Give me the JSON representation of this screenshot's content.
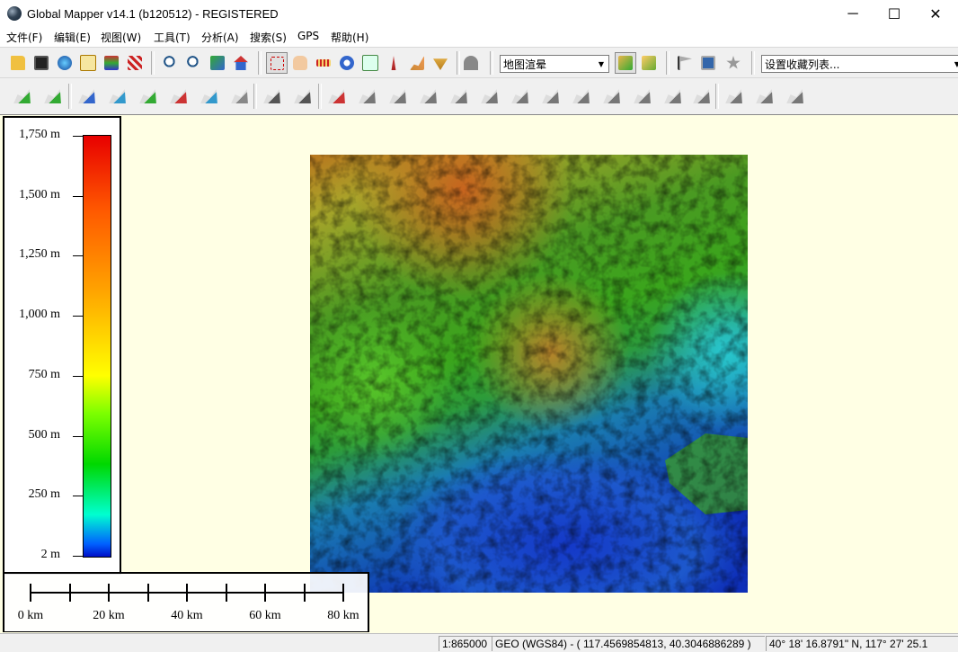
{
  "window": {
    "title": "Global Mapper v14.1 (b120512) - REGISTERED",
    "minimize_glyph": "─",
    "maximize_glyph": "☐",
    "close_glyph": "✕"
  },
  "menu": [
    "文件(F)",
    "编辑(E)",
    "视图(W)",
    "工具(T)",
    "分析(A)",
    "搜索(S)",
    "GPS",
    "帮助(H)"
  ],
  "toolbar1": {
    "icons": [
      "open-icon",
      "save-icon",
      "globe-icon",
      "catalog-icon",
      "control-center-icon",
      "config-icon",
      "zoom-in-icon",
      "zoom-out-icon",
      "full-view-icon",
      "home-icon",
      "zoom-box-icon",
      "pan-icon",
      "measure-icon",
      "info-icon",
      "digitizer-icon",
      "path-profile-icon",
      "view-shed-icon",
      "contour-icon",
      "tunnel-icon",
      "3d-view-icon",
      "3d-window-icon",
      "flag-icon",
      "screen-icon",
      "star-icon"
    ],
    "shader_select": "地图渲晕",
    "favorites_select": "设置收藏列表..."
  },
  "toolbar2": {
    "icons": [
      "create-area-icon",
      "create-line-icon",
      "edit-area-icon",
      "edit-vertices-icon",
      "move-feature-icon",
      "code-tool-icon",
      "buffer-icon",
      "grid-icon",
      "split-icon",
      "cut-icon",
      "smooth-icon",
      "shape-1-icon",
      "shape-2-icon",
      "shape-3-icon",
      "shape-4-icon",
      "shape-5-icon",
      "shape-6-icon",
      "shape-7-icon",
      "shape-8-icon",
      "shape-9-icon",
      "shape-10-icon",
      "shape-11-icon",
      "shape-12-icon",
      "shape-13-icon",
      "undo-icon",
      "redo-icon",
      "rotate-icon"
    ]
  },
  "legend": {
    "labels": [
      "1,750 m",
      "1,500 m",
      "1,250 m",
      "1,000 m",
      "750 m",
      "500 m",
      "250 m",
      "2 m"
    ],
    "colors": {
      "high": "#e80000",
      "mid": "#ffff00",
      "low": "#0010c8"
    }
  },
  "scale": {
    "labels": [
      "0 km",
      "20 km",
      "40 km",
      "60 km",
      "80 km"
    ]
  },
  "status": {
    "scale": "1:865000",
    "projection": "GEO (WGS84) - ( 117.4569854813, 40.3046886289 )",
    "coordinates": "40° 18' 16.8791\" N, 117° 27' 25.1"
  }
}
